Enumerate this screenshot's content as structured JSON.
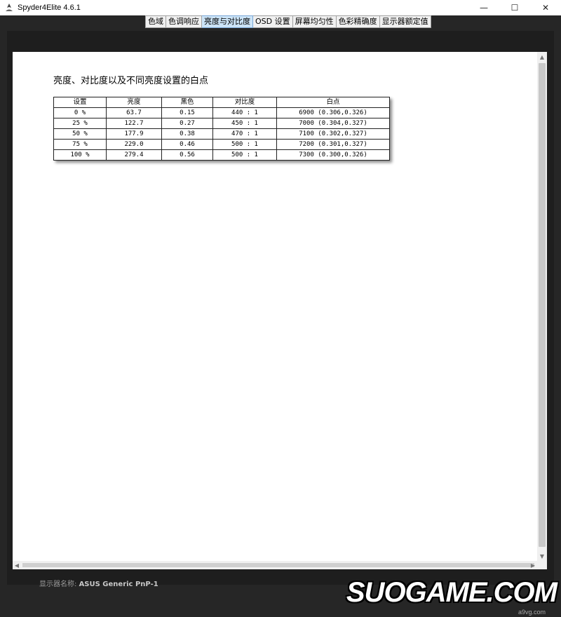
{
  "window": {
    "title": "Spyder4Elite 4.6.1",
    "minimize_glyph": "—",
    "maximize_glyph": "☐",
    "close_glyph": "✕"
  },
  "tabs": [
    {
      "label": "色域"
    },
    {
      "label": "色调响应"
    },
    {
      "label": "亮度与对比度",
      "active": true
    },
    {
      "label": "OSD 设置"
    },
    {
      "label": "屏幕均匀性"
    },
    {
      "label": "色彩精确度"
    },
    {
      "label": "显示器额定值"
    }
  ],
  "toolbar": {
    "icons": [
      "zoom-in-icon",
      "zoom-out-icon",
      "zoom-fit-icon"
    ]
  },
  "report": {
    "title": "亮度、对比度以及不同亮度设置的白点",
    "columns": [
      "设置",
      "亮度",
      "黑色",
      "对比度",
      "白点"
    ],
    "rows": [
      [
        "0 %",
        "63.7",
        "0.15",
        "440 : 1",
        "6900 (0.306,0.326)"
      ],
      [
        "25 %",
        "122.7",
        "0.27",
        "450 : 1",
        "7000 (0.304,0.327)"
      ],
      [
        "50 %",
        "177.9",
        "0.38",
        "470 : 1",
        "7100 (0.302,0.327)"
      ],
      [
        "75 %",
        "229.0",
        "0.46",
        "500 : 1",
        "7200 (0.301,0.327)"
      ],
      [
        "100 %",
        "279.4",
        "0.56",
        "500 : 1",
        "7300 (0.300,0.326)"
      ]
    ]
  },
  "footer": {
    "display_name_label": "显示器名称:",
    "display_name_value": "ASUS Generic PnP-1"
  },
  "watermark": {
    "text": "SUOGAME.COM",
    "sub": "a9vg.com"
  },
  "colors": {
    "app_background": "#262626",
    "page_background": "#ffffff",
    "active_tab": "#cce4f7"
  }
}
